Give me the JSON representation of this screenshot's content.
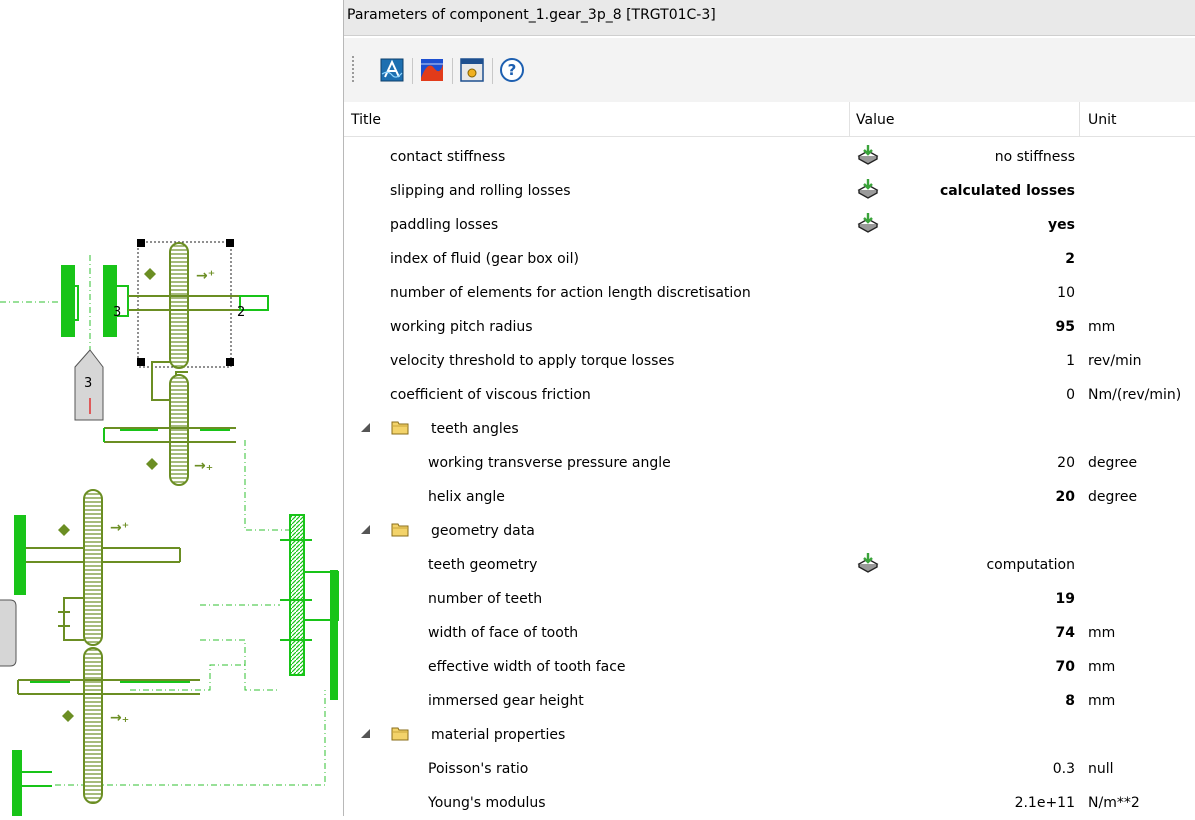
{
  "window": {
    "title": "Parameters of component_1.gear_3p_8 [TRGT01C-3]"
  },
  "toolbar": {
    "buttons": [
      {
        "name": "chart-a-icon"
      },
      {
        "name": "curve-plot-icon"
      },
      {
        "name": "settings-window-icon"
      },
      {
        "name": "help-icon"
      }
    ]
  },
  "table": {
    "columns": {
      "title": "Title",
      "value": "Value",
      "unit": "Unit"
    },
    "rows": [
      {
        "title": "contact stiffness",
        "value": "no stiffness",
        "unit": "",
        "bold": false,
        "icon": true
      },
      {
        "title": "slipping and rolling losses",
        "value": "calculated losses",
        "unit": "",
        "bold": true,
        "icon": true
      },
      {
        "title": "paddling losses",
        "value": "yes",
        "unit": "",
        "bold": true,
        "icon": true
      },
      {
        "title": "index of fluid (gear box oil)",
        "value": "2",
        "unit": "",
        "bold": true
      },
      {
        "title": "number of elements for action length discretisation",
        "value": "10",
        "unit": "",
        "bold": false
      },
      {
        "title": "working pitch radius",
        "value": "95",
        "unit": "mm",
        "bold": true
      },
      {
        "title": "velocity threshold to apply torque losses",
        "value": "1",
        "unit": "rev/min",
        "bold": false
      },
      {
        "title": "coefficient of viscous friction",
        "value": "0",
        "unit": "Nm/(rev/min)",
        "bold": false
      },
      {
        "title": "teeth angles",
        "group": true
      },
      {
        "title": "working transverse pressure angle",
        "value": "20",
        "unit": "degree",
        "bold": false,
        "indent": true
      },
      {
        "title": "helix angle",
        "value": "20",
        "unit": "degree",
        "bold": true,
        "indent": true
      },
      {
        "title": "geometry data",
        "group": true
      },
      {
        "title": "teeth geometry",
        "value": "computation",
        "unit": "",
        "bold": false,
        "indent": true,
        "icon": true
      },
      {
        "title": "number of teeth",
        "value": "19",
        "unit": "",
        "bold": true,
        "indent": true
      },
      {
        "title": "width of face of tooth",
        "value": "74",
        "unit": "mm",
        "bold": true,
        "indent": true
      },
      {
        "title": "effective width of tooth face",
        "value": "70",
        "unit": "mm",
        "bold": true,
        "indent": true
      },
      {
        "title": "immersed gear height",
        "value": "8",
        "unit": "mm",
        "bold": true,
        "indent": true
      },
      {
        "title": "material properties",
        "group": true
      },
      {
        "title": "Poisson's ratio",
        "value": "0.3",
        "unit": "null",
        "bold": false,
        "indent": true
      },
      {
        "title": "Young's modulus",
        "value": "2.1e+11",
        "unit": "N/m**2",
        "bold": false,
        "indent": true
      }
    ]
  },
  "diagram": {
    "port_labels": [
      "3",
      "2",
      "1"
    ],
    "sensor_label": "3"
  },
  "colors": {
    "gear": "#6b8e23",
    "shaft": "#18c418",
    "link": "#30c030"
  }
}
